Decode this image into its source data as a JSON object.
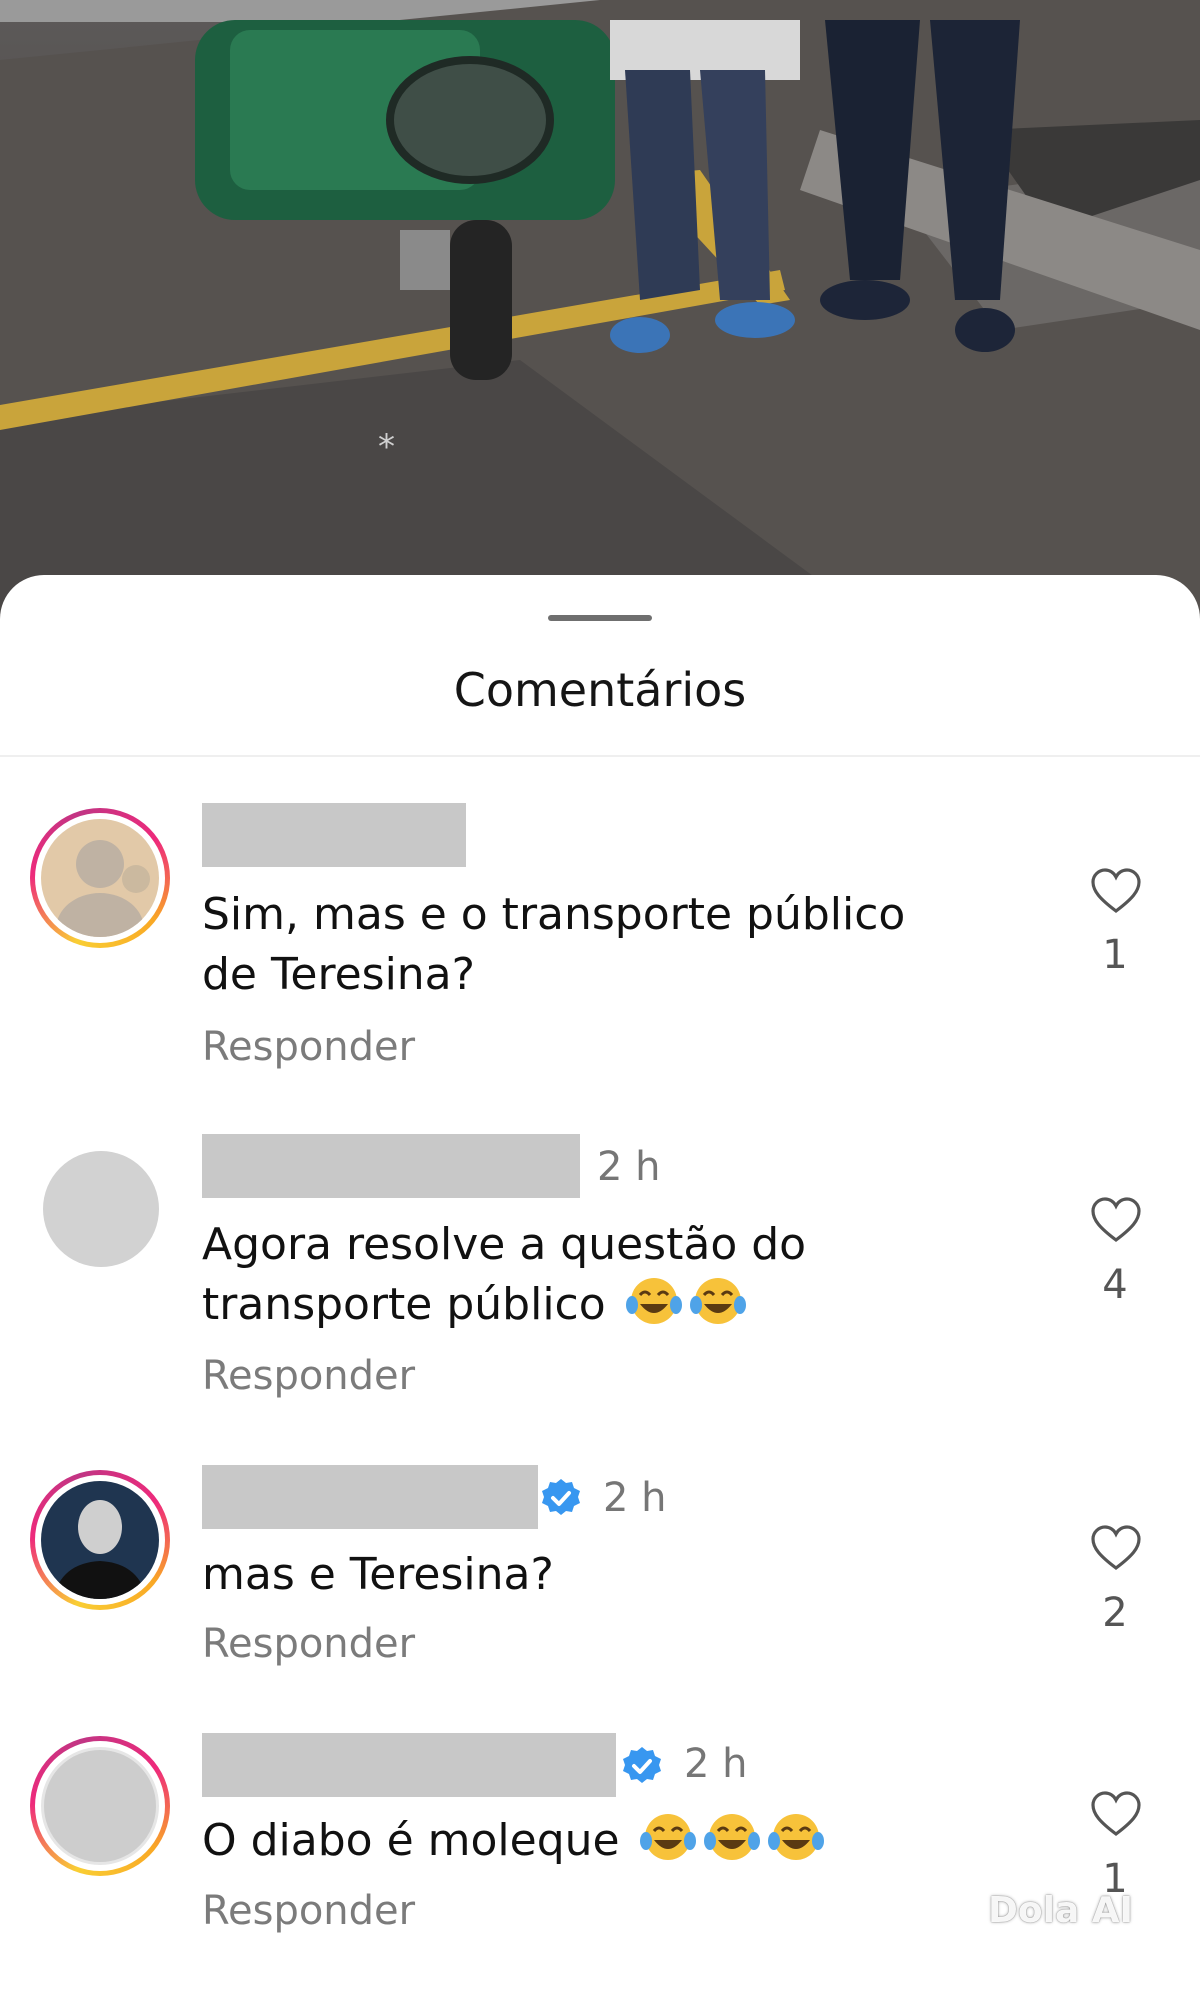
{
  "sheet": {
    "title": "Comentários"
  },
  "comments": [
    {
      "username": "",
      "time": "",
      "verified": false,
      "text_line1": "Sim, mas e o transporte público",
      "text_line2": "de Teresina?",
      "reply_label": "Responder",
      "likes": "1"
    },
    {
      "username": "",
      "time": "2 h",
      "verified": false,
      "text_line1": "Agora resolve a questão do",
      "text_line2": "transporte público",
      "emojis": [
        "face-with-tears-of-joy",
        "face-with-tears-of-joy"
      ],
      "reply_label": "Responder",
      "likes": "4"
    },
    {
      "username": "",
      "time": "2 h",
      "verified": true,
      "text_line1": "mas e Teresina?",
      "reply_label": "Responder",
      "likes": "2"
    },
    {
      "username": "",
      "time": "2 h",
      "verified": true,
      "text_line1": "O diabo é moleque",
      "emojis": [
        "face-with-tears-of-joy",
        "face-with-tears-of-joy",
        "face-with-tears-of-joy"
      ],
      "reply_label": "Responder",
      "likes": "1"
    }
  ],
  "icons": {
    "like": "heart-outline-icon",
    "verified": "verified-badge-icon",
    "emoji": "face-with-tears-of-joy"
  },
  "colors": {
    "verified_blue": "#3897f0",
    "story_ring_start": "#f9ce34",
    "story_ring_mid": "#ee2a7b",
    "story_ring_end": "#c13584"
  },
  "watermark": "Dola AI"
}
